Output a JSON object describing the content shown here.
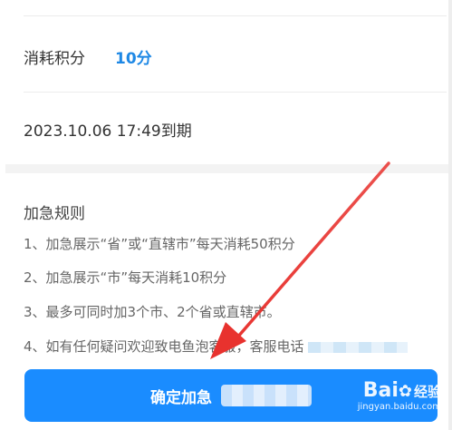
{
  "points_row": {
    "label": "消耗积分",
    "value": "10分"
  },
  "expiry": {
    "text": "2023.10.06 17:49到期"
  },
  "rules": {
    "title": "加急规则",
    "items": [
      "1、加急展示“省”或“直辖市”每天消耗50积分",
      "2、加急展示“市”每天消耗10积分",
      "3、最多可同时加3个市、2个省或直辖市。",
      "4、如有任何疑问欢迎致电鱼泡客服，客服电话"
    ]
  },
  "confirm_button": {
    "label": "确定加急"
  },
  "colors": {
    "accent": "#1e88e5",
    "button": "#1a8cff",
    "annotation_arrow": "#e8322e"
  },
  "watermark": {
    "logo": "Bai",
    "logo_suffix": "经验",
    "url": "jingyan.baidu.com"
  }
}
